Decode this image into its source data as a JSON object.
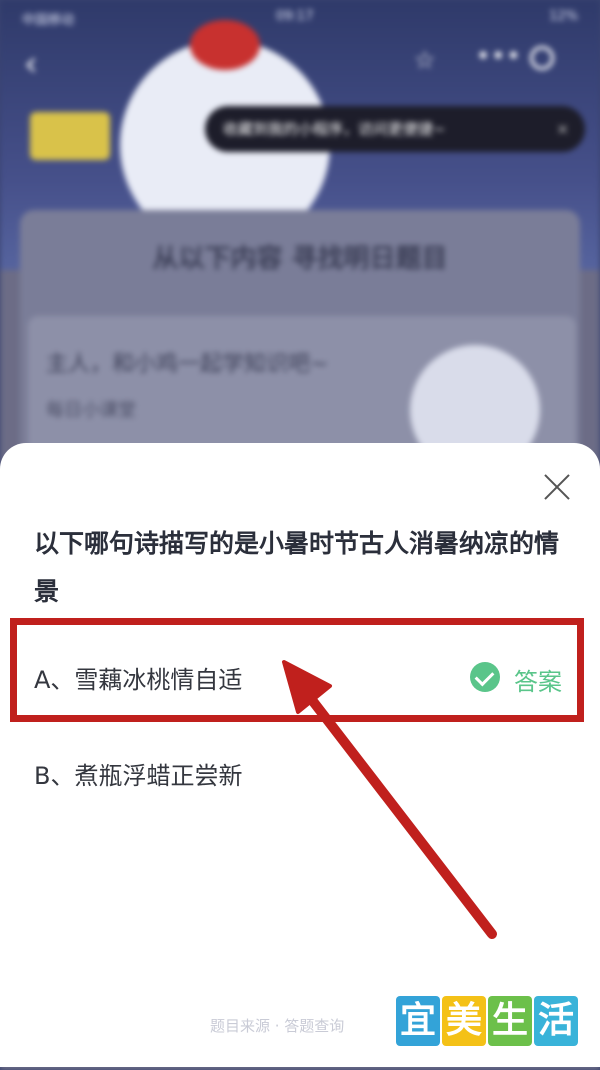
{
  "status_bar": {
    "carrier": "中国移动",
    "time": "09:17",
    "battery": "12%"
  },
  "background": {
    "hint": "收藏到我的小程序，访问更便捷~",
    "hint_close": "×",
    "panel_title": "从以下内容 寻找明日题目",
    "lesson_title": "主人，和小鸡一起学知识吧~",
    "lesson_sub": "每日小课堂"
  },
  "quiz": {
    "question": "以下哪句诗描写的是小暑时节古人消暑纳凉的情景",
    "options": [
      {
        "label": "A、雪藕冰桃情自适",
        "is_answer": true
      },
      {
        "label": "B、煮瓶浮蜡正尝新",
        "is_answer": false
      }
    ],
    "answer_label": "答案"
  },
  "footer": {
    "faded_text": "题目来源 · 答题查询"
  },
  "watermark": {
    "chars": [
      "宜",
      "美",
      "生",
      "活"
    ]
  },
  "colors": {
    "accent_green": "#5ac58a",
    "highlight_red": "#c0201d"
  }
}
